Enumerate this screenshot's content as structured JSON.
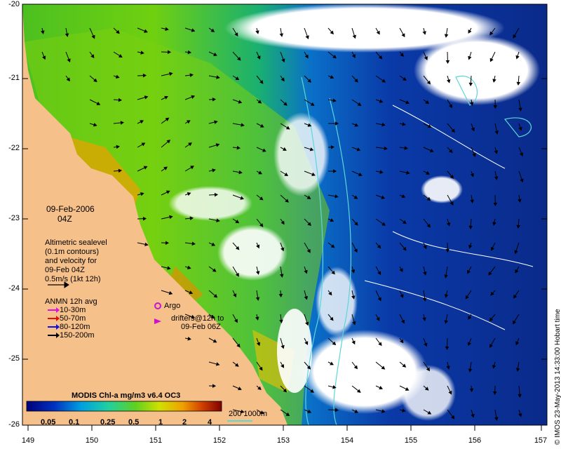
{
  "map": {
    "date": "09-Feb-2006",
    "time": "04Z",
    "altimetry_note": [
      "Altimetric sealevel",
      "(0.1m contours)",
      "and velocity for",
      "09-Feb 04Z",
      "0.5m/s (1kt 12h)"
    ],
    "anmn_title": "ANMN 12h avg",
    "anmn_items": [
      {
        "label": "10-30m",
        "color": "#e010e0"
      },
      {
        "label": "50-70m",
        "color": "#e01010"
      },
      {
        "label": "80-120m",
        "color": "#1010e0"
      },
      {
        "label": "150-200m",
        "color": "#000000"
      }
    ],
    "argo_label": "Argo",
    "drifters_label": [
      "drifters@12h to",
      "09-Feb 06Z"
    ],
    "colorbar_title": "MODIS Chl-a mg/m3 v6.4 OC3",
    "colorbar_ticks": [
      "0.05",
      "0.1",
      "0.25",
      "0.5",
      "1",
      "2",
      "4"
    ],
    "depth_contours_label": "200  1000m",
    "credit": "© IMOS 23-May-2013 14:33:00 Hobart time",
    "lat_ticks": [
      "-20",
      "-21",
      "-22",
      "-23",
      "-24",
      "-25",
      "-26"
    ],
    "lon_ticks": [
      "149",
      "150",
      "151",
      "152",
      "153",
      "154",
      "155",
      "156",
      "157"
    ],
    "colors": {
      "land": "#f5c08a",
      "ocean_blue": "#0a2a9a",
      "contour_cyan": "#5cd6d6",
      "argo": "#d010d0"
    }
  }
}
